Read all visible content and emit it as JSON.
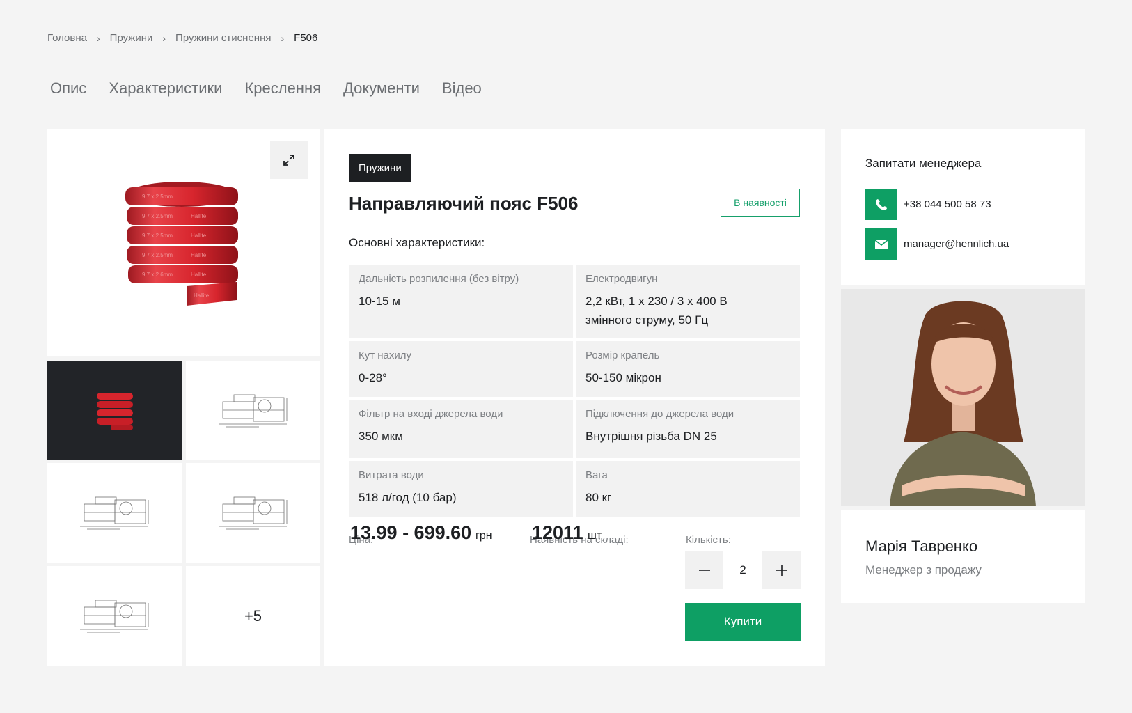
{
  "breadcrumb": {
    "items": [
      "Головна",
      "Пружини",
      "Пружини стиснення"
    ],
    "current": "F506"
  },
  "tabs": [
    "Опис",
    "Характеристики",
    "Креслення",
    "Документи",
    "Відео"
  ],
  "gallery": {
    "more_label": "+5"
  },
  "product": {
    "category": "Пружини",
    "title": "Направляючий пояс F506",
    "stock_status": "В наявності",
    "specs_title": "Основні характеристики:",
    "specs": [
      {
        "label": "Дальність розпилення (без вітру)",
        "value": "10-15 м"
      },
      {
        "label": "Електродвигун",
        "value": "2,2 кВт, 1 х 230 / 3 х 400 В змінного струму, 50 Гц"
      },
      {
        "label": "Кут нахилу",
        "value": "0-28°"
      },
      {
        "label": "Розмір крапель",
        "value": "50-150 мікрон"
      },
      {
        "label": "Фільтр на вході джерела води",
        "value": "350 мкм"
      },
      {
        "label": "Підключення до джерела води",
        "value": "Внутрішня різьба DN 25"
      },
      {
        "label": "Витрата води",
        "value": "518 л/год (10 бар)"
      },
      {
        "label": "Вага",
        "value": "80 кг"
      }
    ],
    "price_label": "Ціна:",
    "price": "13.99 - 699.60",
    "price_unit": "грн",
    "stock_label": "Наявність на складі:",
    "stock_count": "12011",
    "stock_unit": "шт",
    "qty_label": "Кількість:",
    "qty_value": "2",
    "buy_label": "Купити"
  },
  "manager": {
    "heading": "Запитати менеджера",
    "phone": "+38 044 500 58 73",
    "email": "manager@hennlich.ua",
    "name": "Марія Тавренко",
    "role": "Менеджер з продажу"
  },
  "colors": {
    "accent": "#0e9f64",
    "spring": "#d7252d",
    "dark": "#1d1f22"
  }
}
